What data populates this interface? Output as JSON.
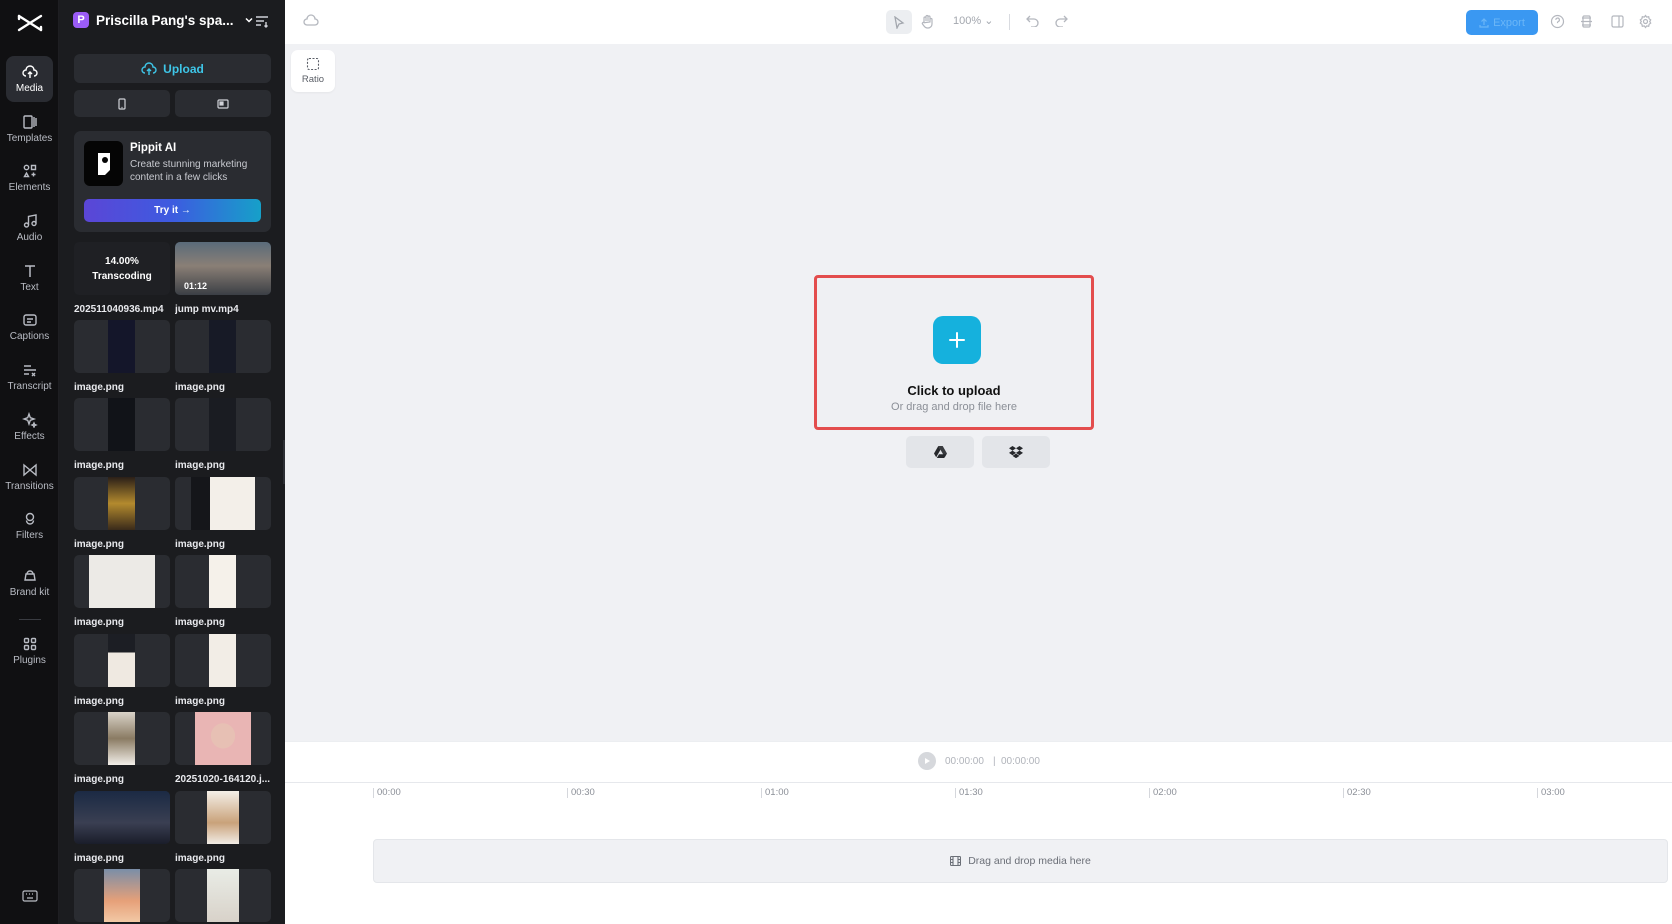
{
  "rail": {
    "items": [
      {
        "label": "Media",
        "icon": "cloud-upload-icon"
      },
      {
        "label": "Templates",
        "icon": "templates-icon"
      },
      {
        "label": "Elements",
        "icon": "elements-icon"
      },
      {
        "label": "Audio",
        "icon": "music-note-icon"
      },
      {
        "label": "Text",
        "icon": "text-icon"
      },
      {
        "label": "Captions",
        "icon": "captions-icon"
      },
      {
        "label": "Transcript",
        "icon": "transcript-icon"
      },
      {
        "label": "Effects",
        "icon": "sparkle-icon"
      },
      {
        "label": "Transitions",
        "icon": "bowtie-icon"
      },
      {
        "label": "Filters",
        "icon": "filters-icon"
      },
      {
        "label": "Brand kit",
        "icon": "brand-kit-icon"
      },
      {
        "label": "Plugins",
        "icon": "plugins-grid-icon"
      }
    ],
    "active": "Media"
  },
  "panel": {
    "space_initial": "P",
    "space_name": "Priscilla Pang's spa...",
    "upload_label": "Upload",
    "promo": {
      "title": "Pippit AI",
      "description": "Create stunning marketing content in a few clicks",
      "button": "Try it →"
    },
    "media": [
      {
        "name": "202511040936.mp4",
        "status_pct": "14.00%",
        "status": "Transcoding"
      },
      {
        "name": "jump mv.mp4",
        "duration": "01:12"
      },
      {
        "name": "image.png"
      },
      {
        "name": "image.png"
      },
      {
        "name": "image.png"
      },
      {
        "name": "image.png"
      },
      {
        "name": "image.png"
      },
      {
        "name": "image.png"
      },
      {
        "name": "image.png"
      },
      {
        "name": "image.png"
      },
      {
        "name": "image.png"
      },
      {
        "name": "image.png"
      },
      {
        "name": "image.png"
      },
      {
        "name": "20251020-164120.j..."
      },
      {
        "name": "image.png"
      },
      {
        "name": "image.png"
      },
      {
        "name": ""
      },
      {
        "name": ""
      }
    ]
  },
  "topbar": {
    "zoom": "100%",
    "export_label": "Export"
  },
  "canvas": {
    "ratio_label": "Ratio",
    "upload_title": "Click to upload",
    "upload_sub": "Or drag and drop file here"
  },
  "timeline": {
    "current_time": "00:00:00",
    "separator": "|",
    "total_time": "00:00:00",
    "ticks": [
      "00:00",
      "00:30",
      "01:00",
      "01:30",
      "02:00",
      "02:30",
      "03:00"
    ],
    "drop_label": "Drag and drop media here"
  },
  "colors": {
    "accent": "#15b1dd",
    "highlight": "#e34d4d",
    "export": "#3a98f2",
    "rail_bg": "#101012",
    "panel_bg": "#1b1c1f"
  }
}
